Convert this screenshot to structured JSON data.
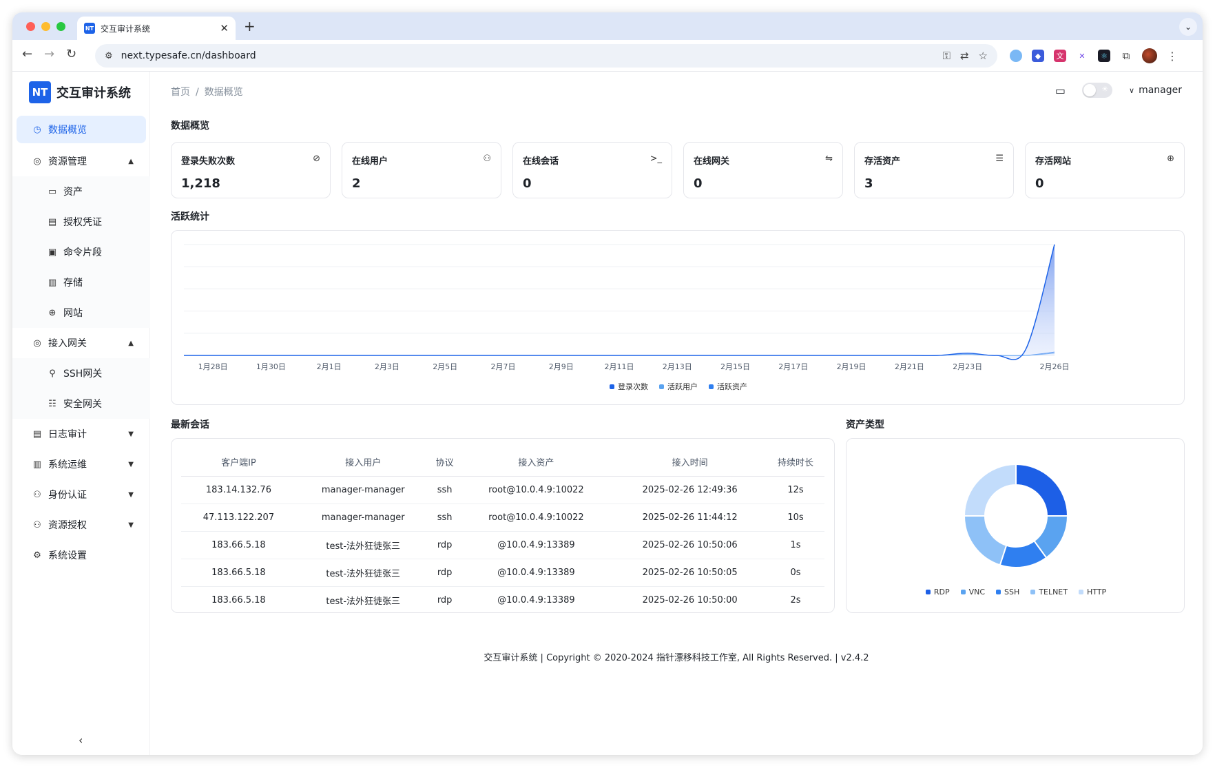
{
  "browser": {
    "tab_title": "交互审计系统",
    "tab_favicon": "NT",
    "url": "next.typesafe.cn/dashboard"
  },
  "sidebar": {
    "logo": "NT",
    "app_name": "交互审计系统",
    "items": [
      {
        "label": "数据概览",
        "icon": "dashboard-icon",
        "active": true
      },
      {
        "label": "资源管理",
        "icon": "resource-icon",
        "expanded": true,
        "children": [
          {
            "label": "资产",
            "icon": "monitor-icon"
          },
          {
            "label": "授权凭证",
            "icon": "credential-icon"
          },
          {
            "label": "命令片段",
            "icon": "terminal-icon"
          },
          {
            "label": "存储",
            "icon": "storage-icon"
          },
          {
            "label": "网站",
            "icon": "globe-icon"
          }
        ]
      },
      {
        "label": "接入网关",
        "icon": "gateway-icon",
        "expanded": true,
        "children": [
          {
            "label": "SSH网关",
            "icon": "plug-icon"
          },
          {
            "label": "安全网关",
            "icon": "network-icon"
          }
        ]
      },
      {
        "label": "日志审计",
        "icon": "log-icon"
      },
      {
        "label": "系统运维",
        "icon": "ops-icon"
      },
      {
        "label": "身份认证",
        "icon": "user-icon"
      },
      {
        "label": "资源授权",
        "icon": "user-auth-icon"
      },
      {
        "label": "系统设置",
        "icon": "gear-icon"
      }
    ]
  },
  "header": {
    "breadcrumb": [
      "首页",
      "数据概览"
    ],
    "user": "manager"
  },
  "overview": {
    "title": "数据概览",
    "cards": [
      {
        "label": "登录失败次数",
        "value": "1,218",
        "icon": "shield-off-icon"
      },
      {
        "label": "在线用户",
        "value": "2",
        "icon": "users-icon"
      },
      {
        "label": "在线会话",
        "value": "0",
        "icon": "terminal-icon"
      },
      {
        "label": "在线网关",
        "value": "0",
        "icon": "route-icon"
      },
      {
        "label": "存活资产",
        "value": "3",
        "icon": "server-icon"
      },
      {
        "label": "存活网站",
        "value": "0",
        "icon": "globe-icon"
      }
    ]
  },
  "activity": {
    "title": "活跃统计"
  },
  "chart_data": [
    {
      "type": "area",
      "x_tick_labels": [
        "1月28日",
        "1月30日",
        "2月1日",
        "2月3日",
        "2月5日",
        "2月7日",
        "2月9日",
        "2月11日",
        "2月13日",
        "2月15日",
        "2月17日",
        "2月19日",
        "2月21日",
        "2月23日",
        "2月26日"
      ],
      "x": [
        "1月27日",
        "1月28日",
        "1月29日",
        "1月30日",
        "1月31日",
        "2月1日",
        "2月2日",
        "2月3日",
        "2月4日",
        "2月5日",
        "2月6日",
        "2月7日",
        "2月8日",
        "2月9日",
        "2月10日",
        "2月11日",
        "2月12日",
        "2月13日",
        "2月14日",
        "2月15日",
        "2月16日",
        "2月17日",
        "2月18日",
        "2月19日",
        "2月20日",
        "2月21日",
        "2月22日",
        "2月23日",
        "2月24日",
        "2月25日",
        "2月26日"
      ],
      "series": [
        {
          "name": "登录次数",
          "color": "#1d63e8",
          "values": [
            0,
            0,
            0,
            0,
            0,
            0,
            0,
            0,
            0,
            0,
            0,
            0,
            0,
            0,
            0,
            0,
            0,
            0,
            0,
            0,
            0,
            0,
            0,
            0,
            0,
            0,
            0,
            2,
            0,
            5,
            100
          ]
        },
        {
          "name": "活跃用户",
          "color": "#5aa3f0",
          "values": [
            0,
            0,
            0,
            0,
            0,
            0,
            0,
            0,
            0,
            0,
            0,
            0,
            0,
            0,
            0,
            0,
            0,
            0,
            0,
            0,
            0,
            0,
            0,
            0,
            0,
            0,
            0,
            1,
            0,
            0,
            2
          ]
        },
        {
          "name": "活跃资产",
          "color": "#2f7ff0",
          "values": [
            0,
            0,
            0,
            0,
            0,
            0,
            0,
            0,
            0,
            0,
            0,
            0,
            0,
            0,
            0,
            0,
            0,
            0,
            0,
            0,
            0,
            0,
            0,
            0,
            0,
            0,
            0,
            1,
            0,
            0,
            3
          ]
        }
      ],
      "grid": true,
      "legend": "bottom"
    },
    {
      "type": "pie",
      "title": "资产类型",
      "categories": [
        "RDP",
        "VNC",
        "SSH",
        "TELNET",
        "HTTP"
      ],
      "values": [
        25,
        15,
        15,
        20,
        25
      ],
      "colors": [
        "#1d5fe6",
        "#5aa3f0",
        "#2f7ff0",
        "#8ec1f7",
        "#c2dcfb"
      ],
      "legend": "bottom"
    }
  ],
  "sessions": {
    "title": "最新会话",
    "columns": [
      "客户端IP",
      "接入用户",
      "协议",
      "接入资产",
      "接入时间",
      "持续时长"
    ],
    "rows": [
      [
        "183.14.132.76",
        "manager-manager",
        "ssh",
        "root@10.0.4.9:10022",
        "2025-02-26 12:49:36",
        "12s"
      ],
      [
        "47.113.122.207",
        "manager-manager",
        "ssh",
        "root@10.0.4.9:10022",
        "2025-02-26 11:44:12",
        "10s"
      ],
      [
        "183.66.5.18",
        "test-法外狂徒张三",
        "rdp",
        "@10.0.4.9:13389",
        "2025-02-26 10:50:06",
        "1s"
      ],
      [
        "183.66.5.18",
        "test-法外狂徒张三",
        "rdp",
        "@10.0.4.9:13389",
        "2025-02-26 10:50:05",
        "0s"
      ],
      [
        "183.66.5.18",
        "test-法外狂徒张三",
        "rdp",
        "@10.0.4.9:13389",
        "2025-02-26 10:50:00",
        "2s"
      ]
    ]
  },
  "footer": "交互审计系统 | Copyright © 2020-2024 指针漂移科技工作室, All Rights Reserved. | v2.4.2"
}
